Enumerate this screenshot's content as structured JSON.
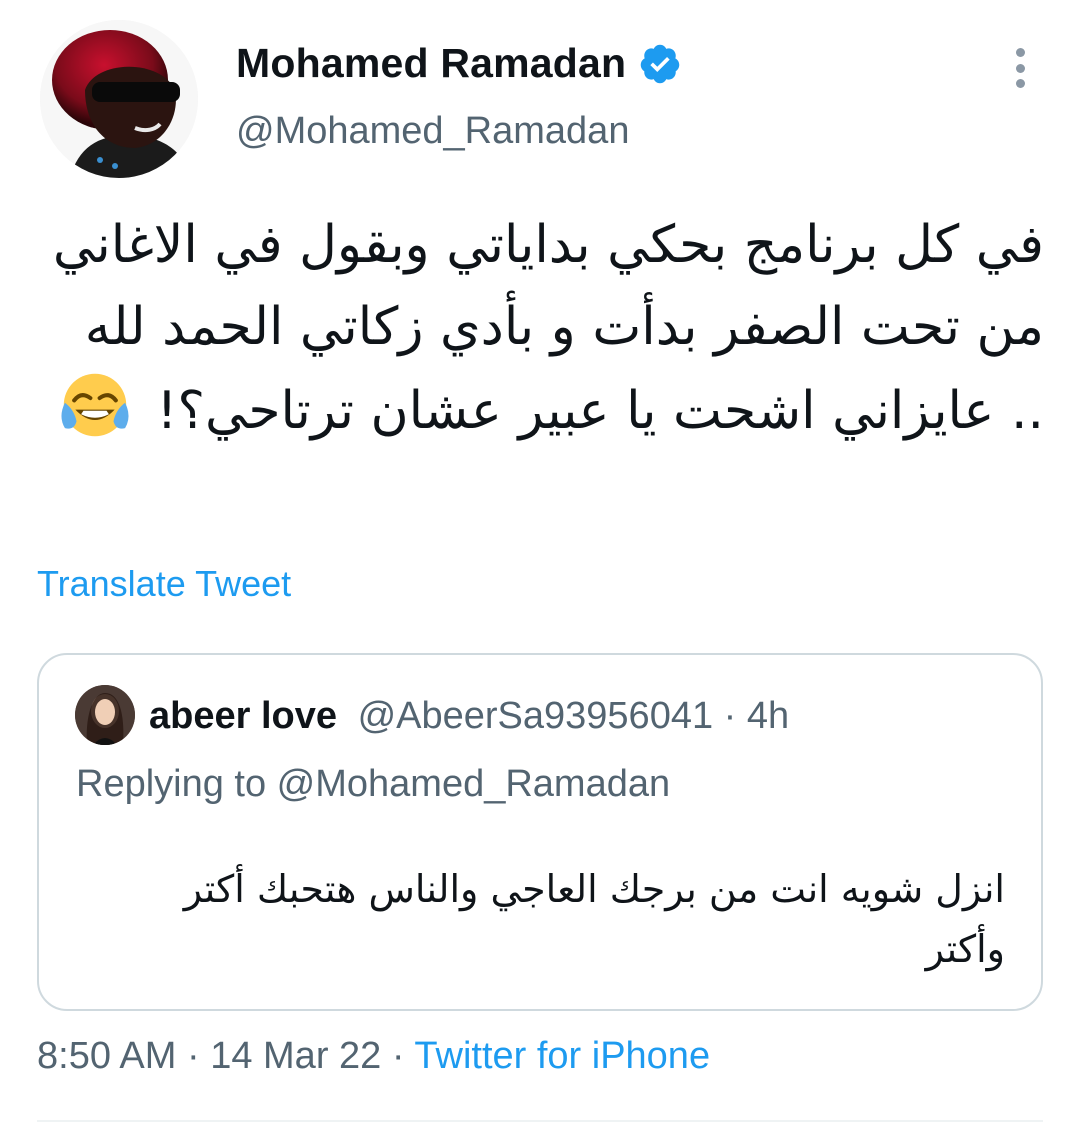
{
  "author": {
    "name": "Mohamed Ramadan",
    "handle": "@Mohamed_Ramadan",
    "verified": true,
    "avatar_icon": "avatar-photo-icon"
  },
  "tweet": {
    "text": "في كل برنامج بحكي بداياتي وبقول في الاغاني من تحت الصفر بدأت و بأدي زكاتي الحمد لله .. عايزاني اشحت يا عبير عشان ترتاحي؟!",
    "emoji": "face-with-tears-of-joy-icon"
  },
  "translate_label": "Translate Tweet",
  "quoted": {
    "name": "abeer love",
    "handle": "@AbeerSa93956041",
    "separator": " · ",
    "time": "4h",
    "replying_prefix": "Replying to ",
    "replying_handle": "@Mohamed_Ramadan",
    "text": "انزل شويه انت من برجك العاجي والناس هتحبك أكتر وأكتر"
  },
  "footer": {
    "time": "8:50 AM",
    "sep1": " · ",
    "date": "14 Mar 22",
    "sep2": " · ",
    "source": "Twitter for iPhone"
  },
  "colors": {
    "accent": "#1d9bf0",
    "secondary_text": "#536471",
    "border": "#cfd9de"
  }
}
